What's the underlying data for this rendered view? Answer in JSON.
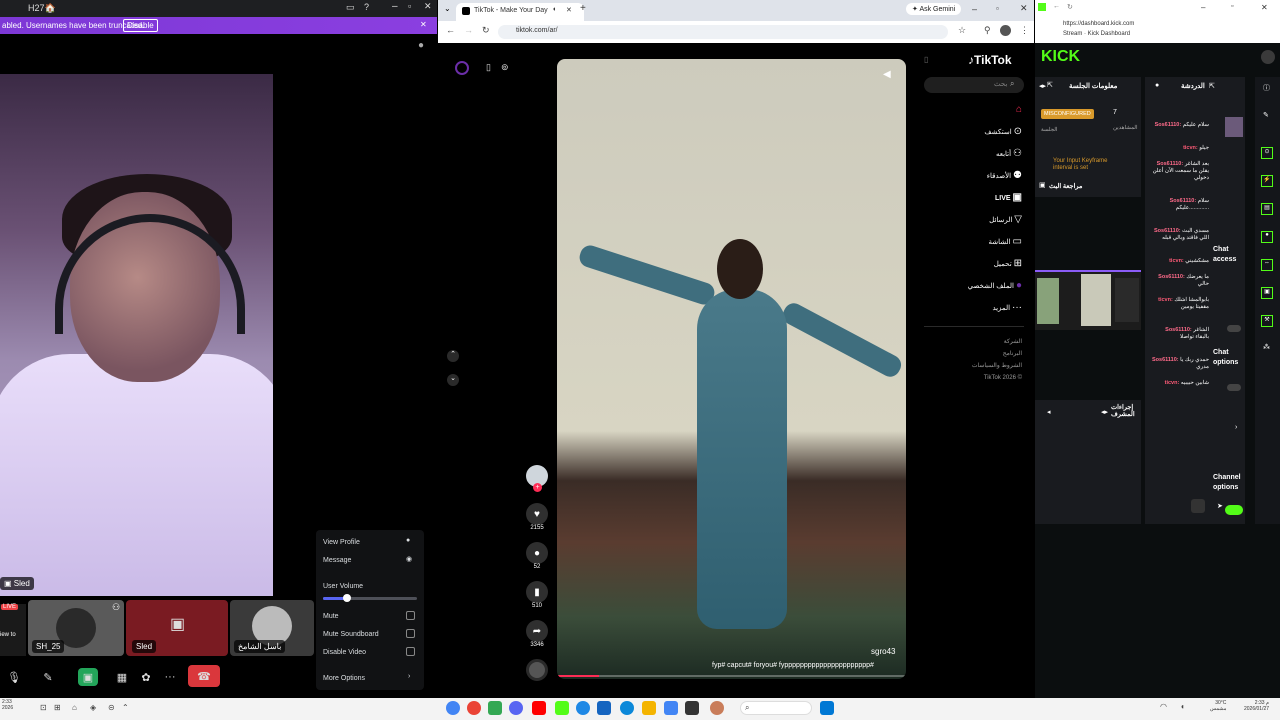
{
  "discord": {
    "window_title": "H27🏠",
    "notice_text": "abled. Usernames have been truncated.",
    "notice_button": "Disable",
    "main_user_tag": "Sled",
    "tiles": [
      {
        "label": "SH_25"
      },
      {
        "label": "Sled"
      },
      {
        "label": "باسل الشامخ"
      }
    ],
    "live_badge": "LIVE",
    "side_label": "iew to",
    "context_menu": {
      "view_profile": "View Profile",
      "message": "Message",
      "user_volume": "User Volume",
      "volume_level": 0.25,
      "mute": "Mute",
      "mute_soundboard": "Mute Soundboard",
      "disable_video": "Disable Video",
      "more_options": "More Options"
    }
  },
  "browser": {
    "tab_title": "TikTok - Make Your Day",
    "url": "tiktok.com/ar/",
    "ask_gemini": "Ask Gemini",
    "tiktok_logo": "TikTok",
    "search_placeholder": "بحث",
    "nav": [
      "",
      "استكشف",
      "أتابعه",
      "الأصدقاء",
      "LIVE",
      "الرسائل",
      "الشاشة",
      "تحميل",
      "الملف الشخصي",
      "المزيد"
    ],
    "footer": [
      "الشركة",
      "البرنامج",
      "الشروط والسياسات",
      "TikTok 2026 ©"
    ],
    "video_user": "sgro43",
    "video_caption": "fyp# capcut# foryou# fypppppppppppppppppppppp#",
    "likes": "2155",
    "comments": "52",
    "saves": "510",
    "shares": "3346"
  },
  "kick": {
    "url": "https://dashboard.kick.com",
    "subtitle": "Stream · Kick Dashboard",
    "logo": "KICK",
    "session_info": "معلومات الجلسة",
    "chat_title": "الدردشة",
    "misconfigured": "MISCONFIGURED",
    "session_label": "الجلسة",
    "viewers_count": "7",
    "viewers_label": "المشاهدين",
    "keyframe_warning": "Your Input Keyframe interval is set",
    "review_stream": "مراجعة البث",
    "mod_actions": "إجراءات المشرف",
    "chat_access": "Chat access",
    "chat_options": "Chat options",
    "channel_options": "Channel options",
    "chat_messages": [
      {
        "user": "Sos61110:",
        "text": "سلام عليكم",
        "color": "pink"
      },
      {
        "user": "ticvn:",
        "text": "جيلو",
        "color": "red"
      },
      {
        "user": "Sos61110:",
        "text": "بعد الشاغر يقلن ما سمعت الآن أعلن دخولي",
        "color": "pink"
      },
      {
        "user": "Sos61110:",
        "text": "سلام عليكم.............",
        "color": "pink"
      },
      {
        "user": "Sos61110:",
        "text": "مسدي البث اللي فاقتد وبالي قبله",
        "color": "pink"
      },
      {
        "user": "ticvn:",
        "text": "مشكشيني",
        "color": "red"
      },
      {
        "user": "Sos61110:",
        "text": "ما يعرضك حالي",
        "color": "pink"
      },
      {
        "user": "ticvn:",
        "text": "بابوالمشا اشلك مقفيتا يومين",
        "color": "red"
      },
      {
        "user": "Sos61110:",
        "text": "الشاغر بالبقاء تواصلا",
        "color": "pink"
      },
      {
        "user": "Sos61110:",
        "text": "حمدي ربك يا مدري",
        "color": "pink"
      },
      {
        "user": "ticvn:",
        "text": "شابين حبيبيه",
        "color": "red"
      }
    ]
  },
  "taskbar": {
    "weather": "30°C",
    "weather_sub": "مشمس",
    "time": "2:33 م",
    "date": "2026/01/27"
  }
}
